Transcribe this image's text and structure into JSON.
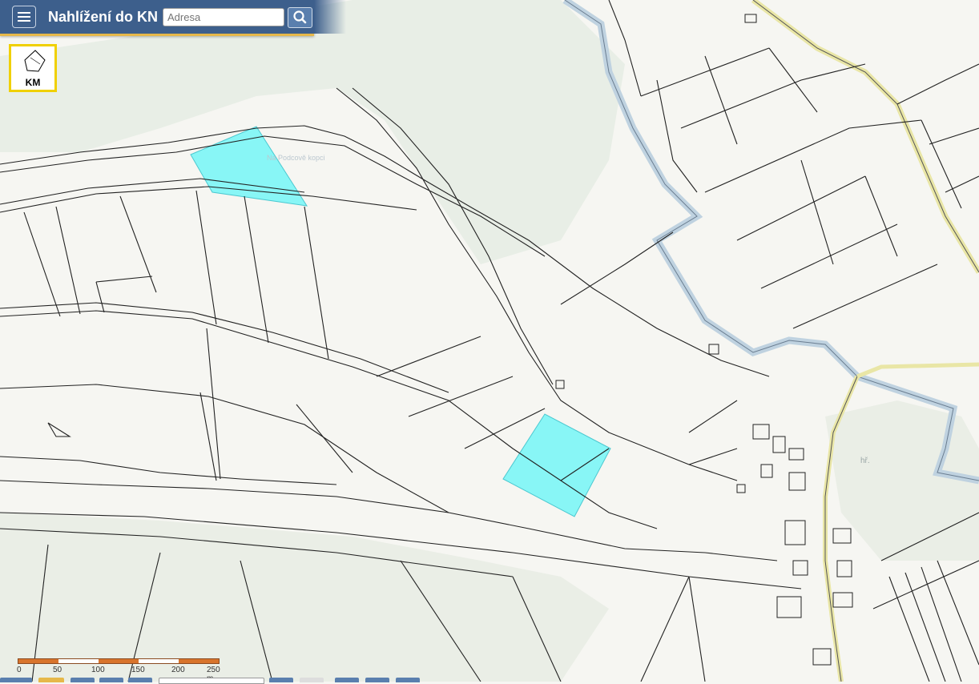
{
  "header": {
    "title": "Nahlížení do KN",
    "search_placeholder": "Adresa",
    "search_value": ""
  },
  "layer_switch": {
    "label": "KM"
  },
  "map": {
    "labels": [
      {
        "text": "Na Podcově kopci"
      },
      {
        "text": "hř."
      }
    ],
    "colors": {
      "background": "#f6f6f2",
      "forest": "#e8eee6",
      "parcel_line": "#222222",
      "highlight": "#88f6f6",
      "water": "#bfd2e0",
      "road": "#e9e6a6"
    }
  },
  "scale": {
    "labels": [
      "0",
      "50",
      "100",
      "150",
      "200",
      "250 m"
    ]
  }
}
